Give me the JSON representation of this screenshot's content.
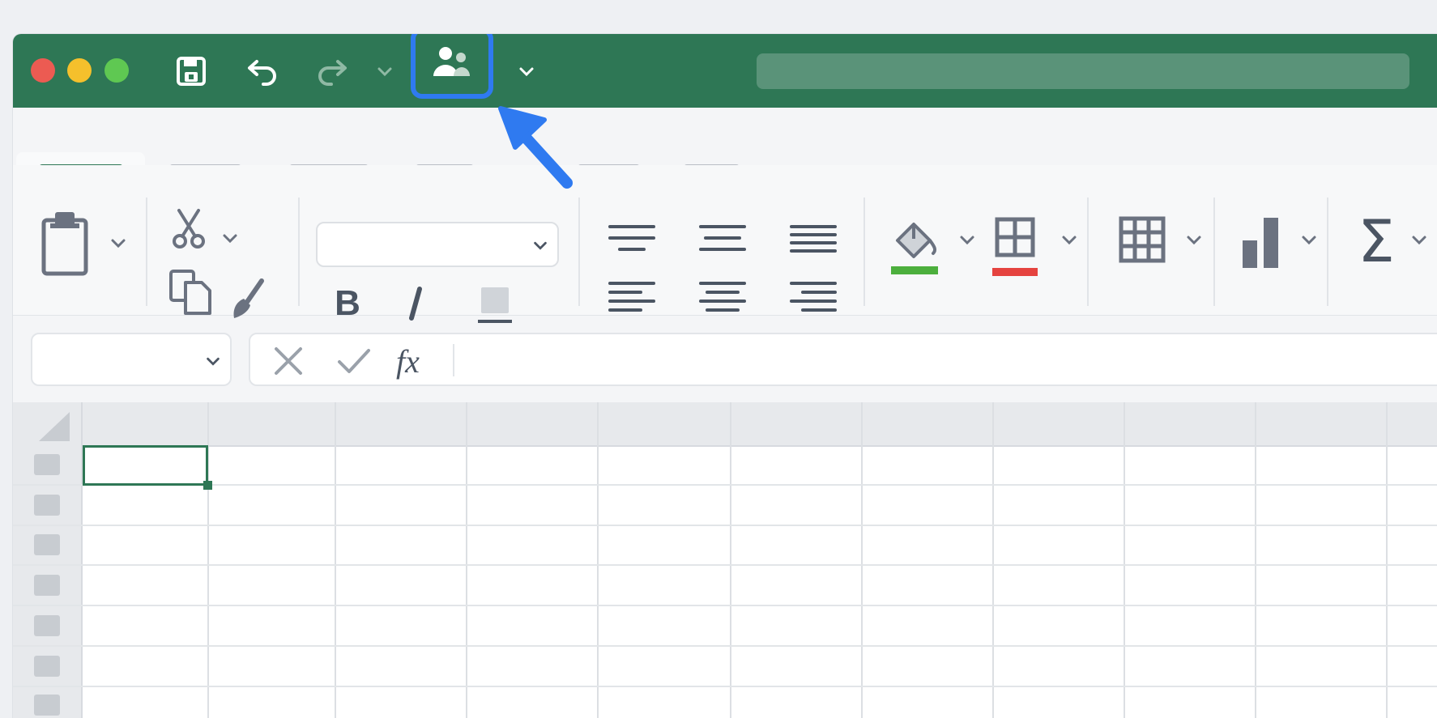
{
  "colors": {
    "titlebar": "#2e7755",
    "accent_highlight": "#2f7af0",
    "fill_color_bar": "#4caf3d",
    "border_color_bar": "#e5433f",
    "selection": "#2e7755"
  },
  "titlebar": {
    "icons": [
      "save-icon",
      "undo-icon",
      "redo-icon",
      "share-people-icon"
    ],
    "highlighted_button": "share-button"
  },
  "ribbon": {
    "tabs_count_note": "",
    "font_name_value": "",
    "icons": [
      "clipboard-paste-icon",
      "cut-icon",
      "copy-icon",
      "format-painter-icon",
      "bold-icon",
      "italic-icon",
      "underline-icon",
      "align-top-icon",
      "align-middle-icon",
      "align-bottom-icon",
      "align-left-icon",
      "align-center-icon",
      "align-right-icon",
      "fill-color-icon",
      "borders-icon",
      "table-icon",
      "chart-icon",
      "sum-icon"
    ],
    "bold_label": "B",
    "italic_label": "/",
    "sum_label": "Σ"
  },
  "formula_bar": {
    "namebox_value": "",
    "fx_label": "fx",
    "formula_value": ""
  }
}
